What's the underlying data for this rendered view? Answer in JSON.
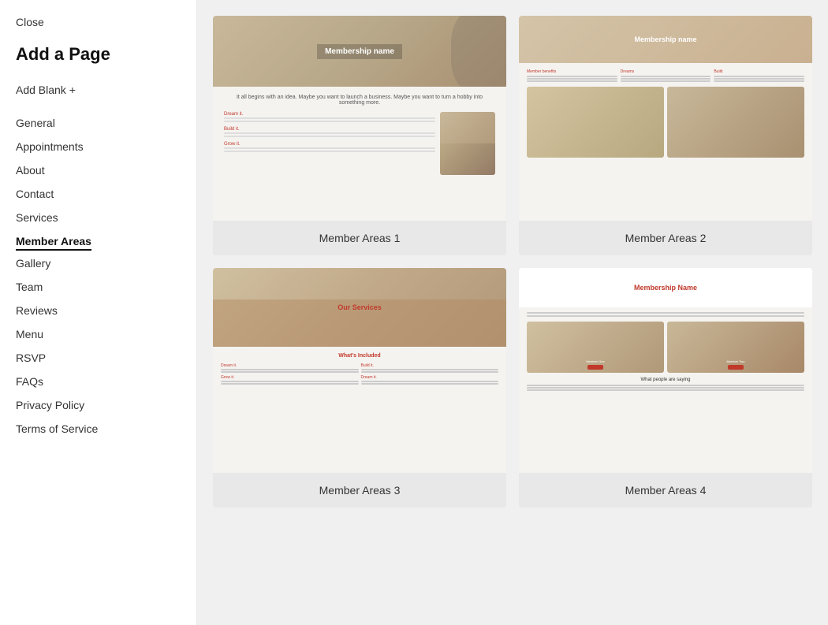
{
  "sidebar": {
    "close_label": "Close",
    "page_title": "Add a Page",
    "add_blank_label": "Add Blank +",
    "nav_items": [
      {
        "id": "general",
        "label": "General",
        "active": false
      },
      {
        "id": "appointments",
        "label": "Appointments",
        "active": false
      },
      {
        "id": "about",
        "label": "About",
        "active": false
      },
      {
        "id": "contact",
        "label": "Contact",
        "active": false
      },
      {
        "id": "services",
        "label": "Services",
        "active": false
      },
      {
        "id": "member-areas",
        "label": "Member Areas",
        "active": true
      },
      {
        "id": "gallery",
        "label": "Gallery",
        "active": false
      },
      {
        "id": "team",
        "label": "Team",
        "active": false
      },
      {
        "id": "reviews",
        "label": "Reviews",
        "active": false
      },
      {
        "id": "menu",
        "label": "Menu",
        "active": false
      },
      {
        "id": "rsvp",
        "label": "RSVP",
        "active": false
      },
      {
        "id": "faqs",
        "label": "FAQs",
        "active": false
      },
      {
        "id": "privacy-policy",
        "label": "Privacy Policy",
        "active": false
      },
      {
        "id": "terms-of-service",
        "label": "Terms of Service",
        "active": false
      }
    ]
  },
  "templates": [
    {
      "id": "member-areas-1",
      "label": "Member Areas 1"
    },
    {
      "id": "member-areas-2",
      "label": "Member Areas 2"
    },
    {
      "id": "member-areas-3",
      "label": "Member Areas 3"
    },
    {
      "id": "member-areas-4",
      "label": "Member Areas 4"
    }
  ]
}
